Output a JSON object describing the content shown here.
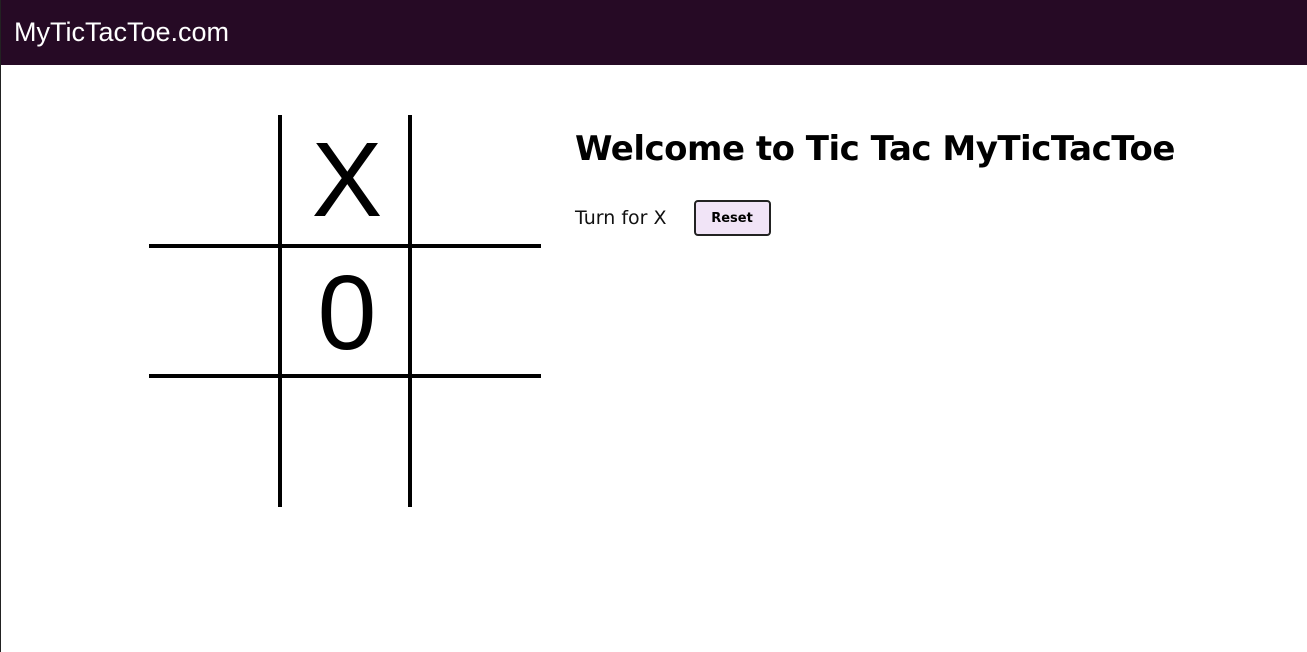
{
  "navbar": {
    "brand": "MyTicTacToe.com",
    "background": "#260a25"
  },
  "board": {
    "cells": [
      "",
      "X",
      "",
      "",
      "0",
      "",
      "",
      "",
      ""
    ]
  },
  "panel": {
    "title": "Welcome to Tic Tac MyTicTacToe",
    "turn_text": "Turn for X",
    "reset_label": "Reset",
    "reset_color": "#f1e4f7"
  }
}
